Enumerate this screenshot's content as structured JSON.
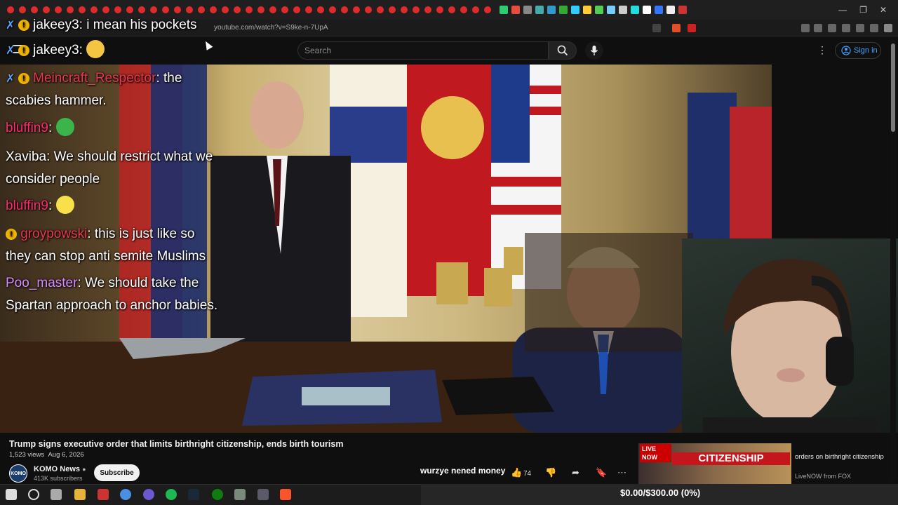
{
  "browser": {
    "url": "youtube.com/watch?v=S9ke-n-7UpA",
    "window_controls": [
      "—",
      "❐",
      "✕"
    ]
  },
  "header": {
    "search_placeholder": "Search",
    "signin_label": "Sign in"
  },
  "chat": [
    {
      "user": "jakeey3",
      "text": ": i mean his pockets",
      "color": "#ffffff"
    },
    {
      "user": "jakeey3",
      "text": ":",
      "color": "#ffffff"
    },
    {
      "user": "Meincraft_Respector",
      "text": ": the",
      "color": "#e8384f"
    },
    {
      "user": "",
      "text": "scabies hammer.",
      "color": "#ffffff"
    },
    {
      "user": "bluffin9",
      "text": ":",
      "color": "#ff2b6e"
    },
    {
      "user": "Xaviba",
      "text": ": We should restrict what we",
      "color": "#ffffff"
    },
    {
      "user": "",
      "text": "consider people",
      "color": "#ffffff"
    },
    {
      "user": "bluffin9",
      "text": ":",
      "color": "#ff2b6e"
    },
    {
      "user": "groypowski",
      "text": ": this is just like so",
      "color": "#e8384f"
    },
    {
      "user": "",
      "text": "they can stop anti semite Muslims",
      "color": "#ffffff"
    },
    {
      "user": "Poo_master",
      "text": ": We should take the",
      "color": "#d98bff"
    },
    {
      "user": "",
      "text": "Spartan approach to anchor babies.",
      "color": "#ffffff"
    }
  ],
  "video": {
    "title": "Trump signs executive order that limits birthright citizenship, ends birth tourism",
    "views": "1,523 views",
    "date": "Aug 6, 2026",
    "channel_name": "KOMO News",
    "channel_avatar": "KOMO",
    "subscribers": "413K subscribers",
    "subscribe_label": "Subscribe",
    "like_count": "74"
  },
  "donation_message": "wurzye nened money",
  "related": {
    "badge": "LIVE NOW",
    "banner": "CITIZENSHIP",
    "title": "orders on birthright citizenship",
    "channel": "LiveNOW from FOX"
  },
  "goal": {
    "text": "$0.00/$300.00 (0%)"
  }
}
